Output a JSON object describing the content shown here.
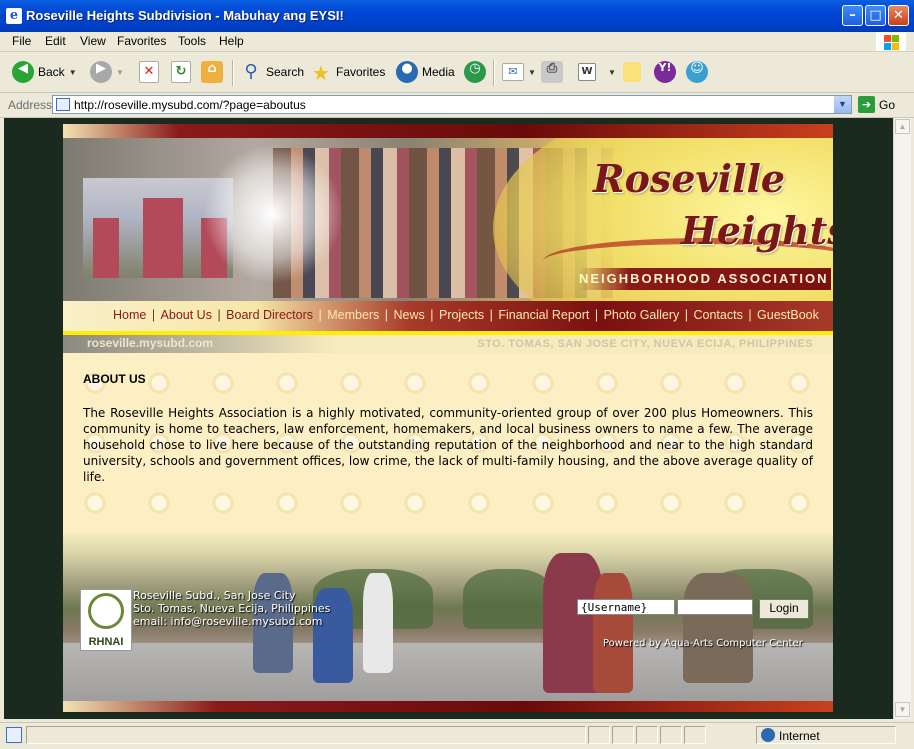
{
  "window": {
    "title": "Roseville Heights Subdivision - Mabuhay ang EYSI!"
  },
  "menu": [
    "File",
    "Edit",
    "View",
    "Favorites",
    "Tools",
    "Help"
  ],
  "toolbar": {
    "back_label": "Back",
    "search_label": "Search",
    "favorites_label": "Favorites",
    "media_label": "Media"
  },
  "address": {
    "label": "Address",
    "url": "http://roseville.mysubd.com/?page=aboutus",
    "go_label": "Go"
  },
  "site": {
    "brand_line1": "Roseville",
    "brand_line2": "Heights",
    "brand_line3": "NEIGHBORHOOD ASSOCIATION",
    "nav": [
      "Home",
      "About Us",
      "Board Directors",
      "Members",
      "News",
      "Projects",
      "Financial Report",
      "Photo Gallery",
      "Contacts",
      "GuestBook"
    ],
    "domain": "roseville.mysubd.com",
    "location": "STO. TOMAS, SAN JOSE CITY, NUEVA ECIJA, PHILIPPINES",
    "about_heading": "ABOUT US",
    "about_text": "The Roseville Heights Association is a highly motivated, community-oriented group of over 200 plus Homeowners. This community is home to teachers, law enforcement, homemakers, and local business owners to name a few. The average household chose to live here because of the outstanding reputation of the neighborhood and near to the high standard university, schools and government offices, low crime, the lack of multi-family housing, and the above average quality of life.",
    "logo_text": "RHNAI",
    "address_lines": [
      "Roseville Subd., San Jose City",
      "Sto. Tomas, Nueva Ecija, Philippines",
      "email: info@roseville.mysubd.com"
    ],
    "username_value": "{Username}",
    "login_label": "Login",
    "powered_by": "Powered by Aqua-Arts Computer Center"
  },
  "status": {
    "zone": "Internet"
  },
  "colors": {
    "xp_blue": "#0046d5",
    "nav_red": "#7a1010",
    "brand_red": "#7a1818"
  }
}
